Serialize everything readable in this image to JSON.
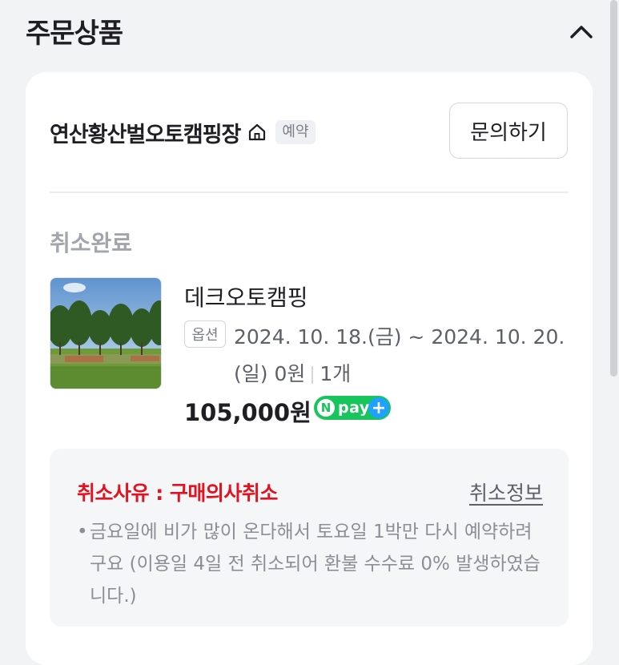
{
  "section": {
    "title": "주문상품",
    "collapse_icon": "chevron-up-icon"
  },
  "store": {
    "name": "연산황산벌오토캠핑장",
    "home_icon": "home-icon",
    "badge": "예약",
    "inquiry_label": "문의하기"
  },
  "order": {
    "status": "취소완료",
    "product_name": "데크오토캠핑",
    "option_tag": "옵션",
    "option_text": "2024. 10. 18.(금) ~ 2024. 10. 20.(일) 0원",
    "quantity": "1개",
    "price": "105,000원",
    "npay": {
      "n": "N",
      "label": "pay",
      "plus": "+"
    }
  },
  "cancellation": {
    "reason": "취소사유 : 구매의사취소",
    "info_link": "취소정보",
    "bullet": "•",
    "note": "금요일에 비가 많이 온다해서 토요일 1박만 다시 예약하려구요 (이용일 4일 전 취소되어 환불 수수료 0% 발생하였습니다.)"
  },
  "colors": {
    "page_bg": "#f2f3f5",
    "card_bg": "#ffffff",
    "cancel_red": "#e4121f",
    "npay_green": "#18c55d",
    "npay_blue": "#1fa1ff",
    "muted_text": "#a2a5ab"
  }
}
